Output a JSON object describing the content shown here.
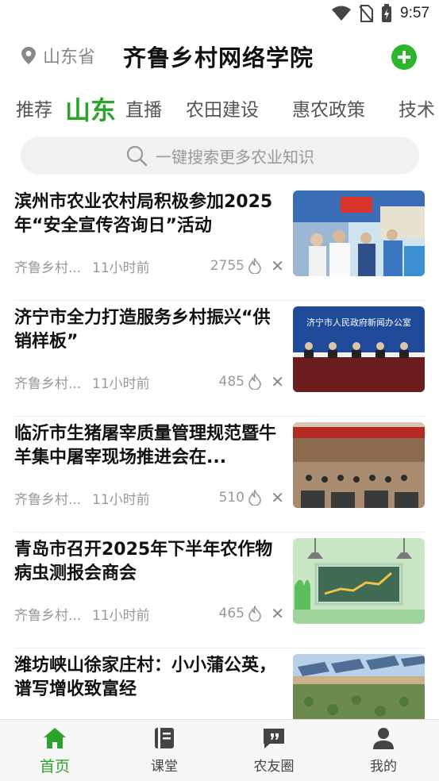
{
  "status": {
    "time": "9:57"
  },
  "header": {
    "location": "山东省",
    "title": "齐鲁乡村网络学院"
  },
  "tabs": [
    "推荐",
    "山东",
    "直播",
    "农田建设",
    "惠农政策",
    "技术"
  ],
  "search": {
    "placeholder": "一键搜索更多农业知识"
  },
  "feed": [
    {
      "title": "滨州市农业农村局积极参加2025年“安全宣传咨询日”活动",
      "source": "齐鲁乡村...",
      "time": "11小时前",
      "count": "2755"
    },
    {
      "title": "济宁市全力打造服务乡村振兴“供销样板”",
      "source": "齐鲁乡村...",
      "time": "11小时前",
      "count": "485",
      "thumb_text": "济宁市人民政府新闻办公室"
    },
    {
      "title": "临沂市生猪屠宰质量管理规范暨牛羊集中屠宰现场推进会在...",
      "source": "齐鲁乡村...",
      "time": "11小时前",
      "count": "510"
    },
    {
      "title": "青岛市召开2025年下半年农作物病虫测报会商会",
      "source": "齐鲁乡村...",
      "time": "11小时前",
      "count": "465"
    },
    {
      "title": "潍坊峡山徐家庄村：小小蒲公英，谱写增收致富经"
    }
  ],
  "tabbar": [
    "首页",
    "课堂",
    "农友圈",
    "我的"
  ],
  "colors": {
    "accent": "#2aa52a"
  }
}
